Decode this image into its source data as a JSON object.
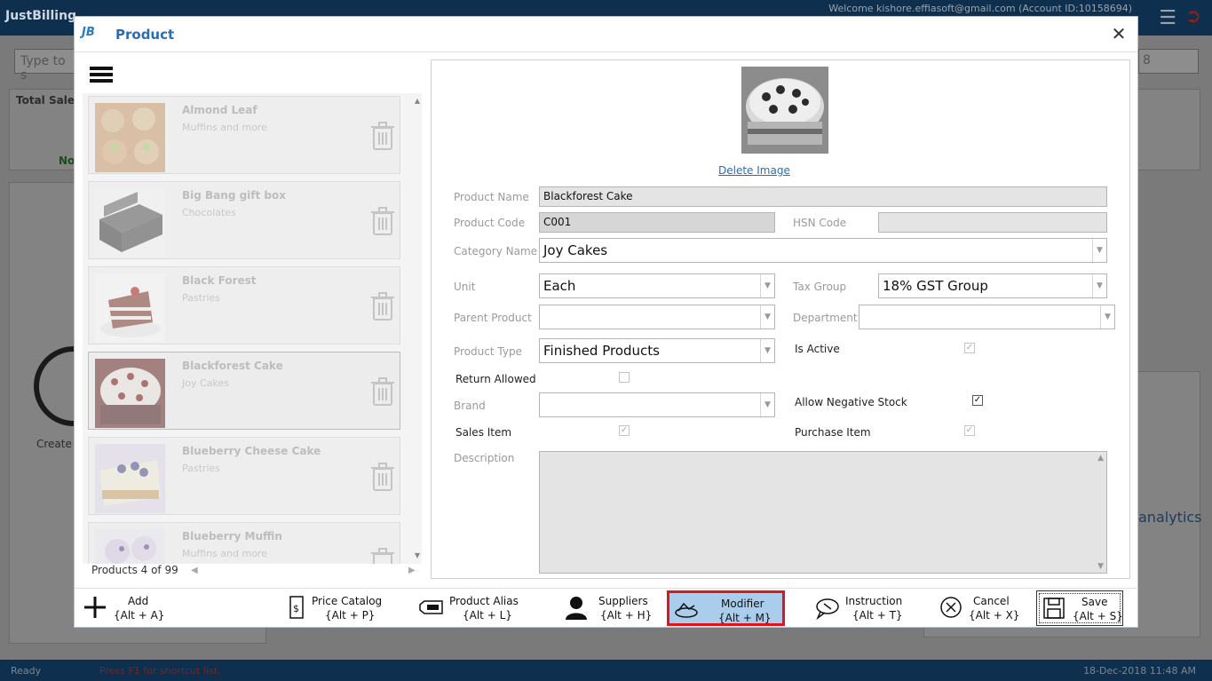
{
  "background": {
    "app_name": "JustBilling",
    "welcome_text": "Welcome kishore.effiasoft@gmail.com (Account ID:10158694)",
    "search_placeholder": "Type to s",
    "select_value": "8",
    "total_sales_label": "Total Sales",
    "no_label": "No",
    "create_label": "Create",
    "analytics_label": "analytics",
    "status_ready": "Ready",
    "status_hint": "Press F1 for shortcut list.",
    "status_datetime": "18-Dec-2018 11:48 AM"
  },
  "dialog": {
    "logo": "JB",
    "title": "Product",
    "close_icon": "close-icon"
  },
  "product_list": {
    "count_label": "Products 4 of 99",
    "items": [
      {
        "name": "Almond Leaf",
        "category": "Muffins and more"
      },
      {
        "name": "Big Bang gift box",
        "category": "Chocolates"
      },
      {
        "name": "Black Forest",
        "category": "Pastries"
      },
      {
        "name": "Blackforest Cake",
        "category": "Joy Cakes"
      },
      {
        "name": "Blueberry Cheese Cake",
        "category": "Pastries"
      },
      {
        "name": "Blueberry Muffin",
        "category": "Muffins and more"
      }
    ],
    "selected_index": 3
  },
  "form": {
    "delete_image_label": "Delete Image",
    "product_name_label": "Product Name",
    "product_name_value": "Blackforest Cake",
    "product_code_label": "Product Code",
    "product_code_value": "C001",
    "hsn_code_label": "HSN Code",
    "hsn_code_value": "",
    "category_name_label": "Category Name",
    "category_name_value": "Joy Cakes",
    "unit_label": "Unit",
    "unit_value": "Each",
    "tax_group_label": "Tax Group",
    "tax_group_value": "18% GST Group",
    "parent_product_label": "Parent Product",
    "parent_product_value": "",
    "department_label": "Department",
    "department_value": "",
    "product_type_label": "Product Type",
    "product_type_value": "Finished Products",
    "is_active_label": "Is Active",
    "is_active": true,
    "return_allowed_label": "Return Allowed",
    "return_allowed": false,
    "brand_label": "Brand",
    "brand_value": "",
    "allow_negative_stock_label": "Allow Negative Stock",
    "allow_negative_stock": true,
    "sales_item_label": "Sales Item",
    "sales_item": true,
    "purchase_item_label": "Purchase Item",
    "purchase_item": true,
    "description_label": "Description",
    "description_value": ""
  },
  "toolbar": {
    "add": {
      "label": "Add",
      "shortcut": "{Alt + A}"
    },
    "price_catalog": {
      "label": "Price Catalog",
      "shortcut": "{Alt + P}"
    },
    "product_alias": {
      "label": "Product Alias",
      "shortcut": "{Alt + L}"
    },
    "suppliers": {
      "label": "Suppliers",
      "shortcut": "{Alt + H}"
    },
    "modifier": {
      "label": "Modifier",
      "shortcut": "{Alt + M}"
    },
    "instruction": {
      "label": "Instruction",
      "shortcut": "{Alt + T}"
    },
    "cancel": {
      "label": "Cancel",
      "shortcut": "{Alt + X}"
    },
    "save": {
      "label": "Save",
      "shortcut": "{Alt + S}"
    }
  },
  "colors": {
    "accent": "#2a6db5",
    "highlight_border": "#e2141b",
    "highlight_fill": "#a9cdea"
  }
}
